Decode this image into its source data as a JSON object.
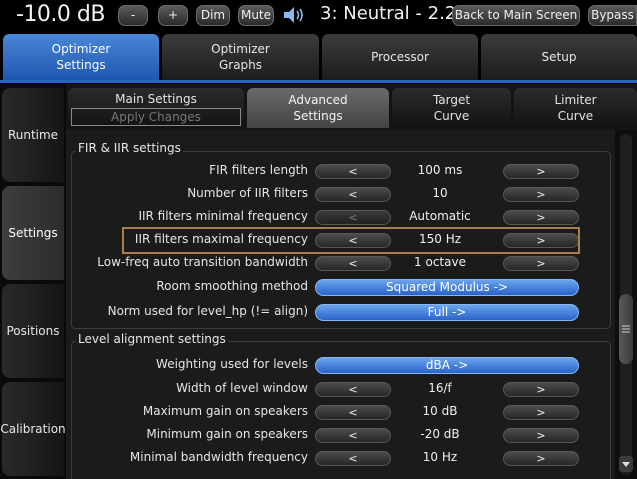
{
  "topbar": {
    "gain": "-10.0 dB",
    "minus_label": "-",
    "plus_label": "+",
    "dim_label": "Dim",
    "mute_label": "Mute",
    "speaker_icon": "speaker-volume-icon",
    "preset": "3: Neutral - 2.2",
    "back_label": "Back to Main Screen",
    "bypass_label": "Bypass"
  },
  "main_tabs": [
    {
      "label": "Optimizer\nSettings",
      "active": true
    },
    {
      "label": "Optimizer\nGraphs",
      "active": false
    },
    {
      "label": "Processor",
      "active": false
    },
    {
      "label": "Setup",
      "active": false
    }
  ],
  "side_tabs": [
    {
      "label": "Runtime",
      "active": false
    },
    {
      "label": "Settings",
      "active": true
    },
    {
      "label": "Positions",
      "active": false
    },
    {
      "label": "Calibration",
      "active": false
    }
  ],
  "sub_tabs": {
    "main_settings": "Main Settings",
    "apply_changes": "Apply Changes",
    "advanced": "Advanced\nSettings",
    "target": "Target\nCurve",
    "limiter": "Limiter\nCurve"
  },
  "fir_iir": {
    "title": "FIR & IIR settings",
    "rows": [
      {
        "label": "FIR filters length",
        "value": "100 ms",
        "left": "<",
        "right": ">",
        "left_enabled": true
      },
      {
        "label": "Number of IIR filters",
        "value": "10",
        "left": "<",
        "right": ">",
        "left_enabled": true
      },
      {
        "label": "IIR filters minimal frequency",
        "value": "Automatic",
        "left": "<",
        "right": ">",
        "left_enabled": false
      },
      {
        "label": "IIR filters maximal frequency",
        "value": "150 Hz",
        "left": "<",
        "right": ">",
        "left_enabled": true
      },
      {
        "label": "Low-freq auto transition bandwidth",
        "value": "1 octave",
        "left": "<",
        "right": ">",
        "left_enabled": true
      }
    ],
    "room_smoothing": {
      "label": "Room smoothing method",
      "value": "Squared Modulus ->"
    },
    "norm_level": {
      "label": "Norm used for level_hp (!= align)",
      "value": "Full ->"
    }
  },
  "level_alignment": {
    "title": "Level alignment settings",
    "weighting": {
      "label": "Weighting used for levels",
      "value": "dBA ->"
    },
    "rows": [
      {
        "label": "Width of level window",
        "value": "16/f",
        "left": "<",
        "right": ">"
      },
      {
        "label": "Maximum gain on speakers",
        "value": "10 dB",
        "left": "<",
        "right": ">"
      },
      {
        "label": "Minimum gain on speakers",
        "value": "-20 dB",
        "left": "<",
        "right": ">"
      },
      {
        "label": "Minimal bandwidth frequency",
        "value": "10 Hz",
        "left": "<",
        "right": ">"
      }
    ]
  },
  "colors": {
    "accent_blue": "#2a63c2",
    "highlight_border": "#a87e4c"
  }
}
